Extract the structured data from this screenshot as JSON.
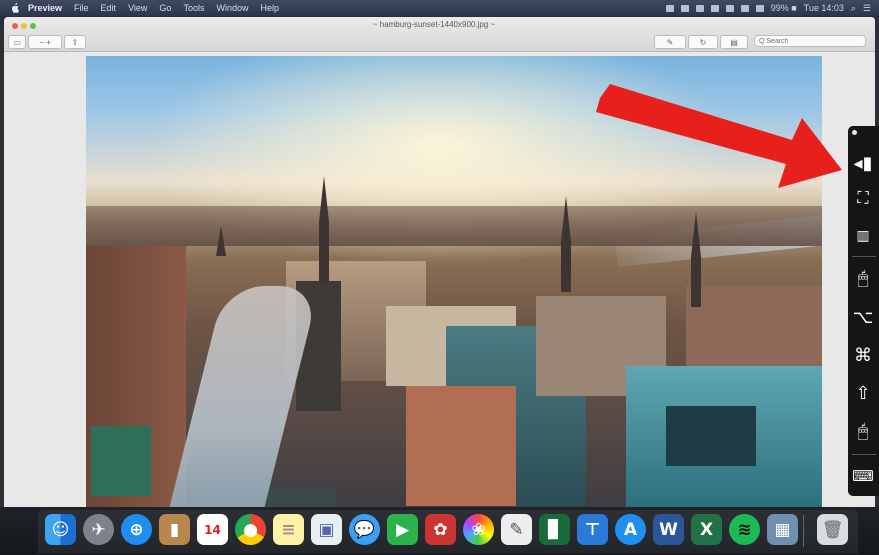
{
  "menubar": {
    "app_name": "Preview",
    "items": [
      "File",
      "Edit",
      "View",
      "Go",
      "Tools",
      "Window",
      "Help"
    ],
    "clock": "Tue 14:03",
    "battery": "99% ■"
  },
  "window": {
    "title": "~ hamburg-sunset-1440x900.jpg ~",
    "search_placeholder": "Q Search"
  },
  "dock": {
    "calendar_day": "14",
    "word_letter": "W",
    "excel_letter": "X"
  },
  "annotation": {
    "arrow_color": "#e8201c"
  },
  "accessibility_keyboard": {
    "keys": [
      "panel-left-key",
      "mouse-pointer-key",
      "keyboard-key",
      "mouse-left-click-key",
      "option-key",
      "command-key",
      "shift-key",
      "mouse-right-click-key",
      "keyboard-toggle-key"
    ]
  }
}
